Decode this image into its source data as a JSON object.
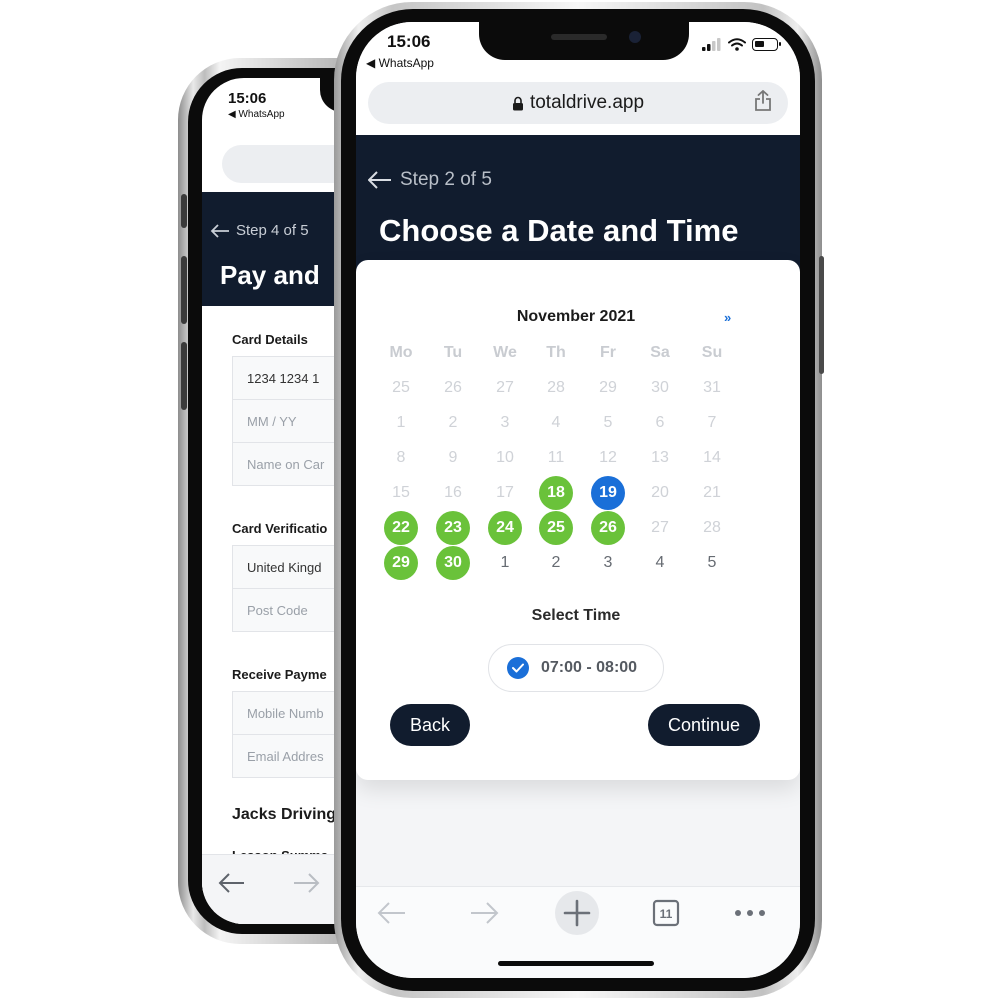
{
  "back_phone": {
    "status": {
      "time": "15:06",
      "back_app": "◀ WhatsApp"
    },
    "header": {
      "step": "Step 4 of 5",
      "title": "Pay and"
    },
    "form": {
      "card_details_label": "Card Details",
      "card_number_value": "1234 1234 1",
      "expiry_placeholder": "MM / YY",
      "name_placeholder": "Name on Car",
      "verification_label": "Card Verificatio",
      "country_value": "United Kingd",
      "postcode_placeholder": "Post Code",
      "receive_label": "Receive Payme",
      "mobile_placeholder": "Mobile Numb",
      "email_placeholder": "Email Addres",
      "business_title": "Jacks Driving",
      "summary_label": "Lesson Summa"
    }
  },
  "front_phone": {
    "status": {
      "time": "15:06",
      "back_app": "◀ WhatsApp"
    },
    "browser": {
      "url": "totaldrive.app",
      "tab_count": "11"
    },
    "header": {
      "step": "Step 2 of 5",
      "title": "Choose a Date and Time"
    },
    "calendar": {
      "month": "November 2021",
      "next_label": "»",
      "weekdays": [
        "Mo",
        "Tu",
        "We",
        "Th",
        "Fr",
        "Sa",
        "Su"
      ],
      "weeks": [
        [
          {
            "d": "25",
            "s": "muted"
          },
          {
            "d": "26",
            "s": "muted"
          },
          {
            "d": "27",
            "s": "muted"
          },
          {
            "d": "28",
            "s": "muted"
          },
          {
            "d": "29",
            "s": "muted"
          },
          {
            "d": "30",
            "s": "muted"
          },
          {
            "d": "31",
            "s": "muted"
          }
        ],
        [
          {
            "d": "1",
            "s": "muted"
          },
          {
            "d": "2",
            "s": "muted"
          },
          {
            "d": "3",
            "s": "muted"
          },
          {
            "d": "4",
            "s": "muted"
          },
          {
            "d": "5",
            "s": "muted"
          },
          {
            "d": "6",
            "s": "muted"
          },
          {
            "d": "7",
            "s": "muted"
          }
        ],
        [
          {
            "d": "8",
            "s": "muted"
          },
          {
            "d": "9",
            "s": "muted"
          },
          {
            "d": "10",
            "s": "muted"
          },
          {
            "d": "11",
            "s": "muted"
          },
          {
            "d": "12",
            "s": "muted"
          },
          {
            "d": "13",
            "s": "muted"
          },
          {
            "d": "14",
            "s": "muted"
          }
        ],
        [
          {
            "d": "15",
            "s": "muted"
          },
          {
            "d": "16",
            "s": "muted"
          },
          {
            "d": "17",
            "s": "muted"
          },
          {
            "d": "18",
            "s": "avail"
          },
          {
            "d": "19",
            "s": "selected"
          },
          {
            "d": "20",
            "s": "muted"
          },
          {
            "d": "21",
            "s": "muted"
          }
        ],
        [
          {
            "d": "22",
            "s": "avail"
          },
          {
            "d": "23",
            "s": "avail"
          },
          {
            "d": "24",
            "s": "avail"
          },
          {
            "d": "25",
            "s": "avail"
          },
          {
            "d": "26",
            "s": "avail"
          },
          {
            "d": "27",
            "s": "muted"
          },
          {
            "d": "28",
            "s": "muted"
          }
        ],
        [
          {
            "d": "29",
            "s": "avail"
          },
          {
            "d": "30",
            "s": "avail"
          },
          {
            "d": "1",
            "s": "next"
          },
          {
            "d": "2",
            "s": "next"
          },
          {
            "d": "3",
            "s": "next"
          },
          {
            "d": "4",
            "s": "next"
          },
          {
            "d": "5",
            "s": "next"
          }
        ]
      ],
      "colors": {
        "available": "#6ac23a",
        "selected": "#1a6fd8"
      }
    },
    "time": {
      "label": "Select Time",
      "slot": "07:00 - 08:00",
      "checked": true
    },
    "actions": {
      "back_label": "Back",
      "continue_label": "Continue"
    }
  },
  "colors": {
    "header_bg": "#111c2e",
    "accent_blue": "#1a6fd8",
    "available_green": "#6ac23a"
  }
}
